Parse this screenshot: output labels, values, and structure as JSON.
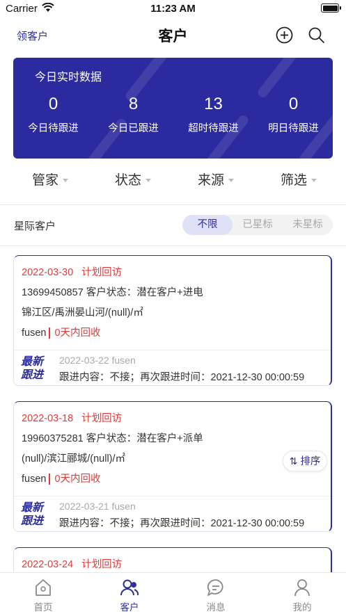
{
  "status_bar": {
    "carrier": "Carrier",
    "time": "11:23 AM"
  },
  "nav": {
    "left_label": "领客户",
    "title": "客户",
    "plus_icon": "plus-circle-icon",
    "search_icon": "search-icon"
  },
  "stats": {
    "heading": "今日实时数据",
    "items": [
      {
        "value": "0",
        "label": "今日待跟进"
      },
      {
        "value": "8",
        "label": "今日已跟进"
      },
      {
        "value": "13",
        "label": "超时待跟进"
      },
      {
        "value": "0",
        "label": "明日待跟进"
      }
    ],
    "bg_color": "#2b2b9f"
  },
  "filters": [
    "管家",
    "状态",
    "来源",
    "筛选"
  ],
  "star_filter": {
    "label": "星际客户",
    "options": [
      "不限",
      "已星标",
      "未星标"
    ],
    "selected": "不限"
  },
  "customers": [
    {
      "date": "2022-03-30",
      "plan": "计划回访",
      "phone_status": "13699450857   客户状态：潜在客户+进电",
      "address": "锦江区/禹洲晏山河/(null)/㎡",
      "owner": "fusen",
      "recycle": "0天内回收",
      "badge": "最新跟进",
      "follow_meta": "2022-03-22 fusen",
      "follow_content": "跟进内容：不接；再次跟进时间：2021-12-30 00:00:59"
    },
    {
      "date": "2022-03-18",
      "plan": "计划回访",
      "phone_status": "19960375281   客户状态：潜在客户+派单",
      "address": "(null)/滨江郦城/(null)/㎡",
      "owner": "fusen",
      "recycle": "0天内回收",
      "badge": "最新跟进",
      "follow_meta": "2022-03-21 fusen",
      "follow_content": "跟进内容：不接；再次跟进时间：2021-12-30 00:00:59"
    },
    {
      "date": "2022-03-24",
      "plan": "计划回访"
    }
  ],
  "sort_button": {
    "label": "排序",
    "icon": "sort-arrows-icon"
  },
  "tabbar": [
    {
      "label": "首页",
      "icon": "home-icon"
    },
    {
      "label": "客户",
      "icon": "customers-icon",
      "active": true
    },
    {
      "label": "消息",
      "icon": "message-icon"
    },
    {
      "label": "我的",
      "icon": "profile-icon"
    }
  ],
  "colors": {
    "accent": "#2e2e9c",
    "alert": "#e03b3b"
  }
}
